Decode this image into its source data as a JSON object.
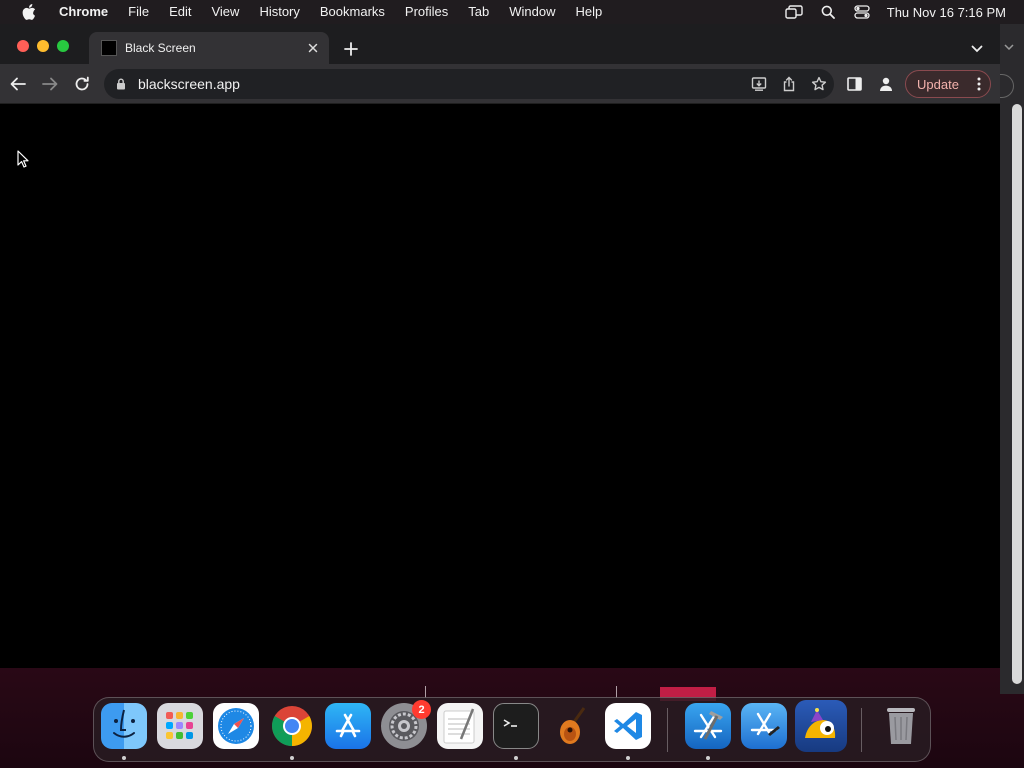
{
  "menubar": {
    "app_name": "Chrome",
    "items": [
      "File",
      "Edit",
      "View",
      "History",
      "Bookmarks",
      "Profiles",
      "Tab",
      "Window",
      "Help"
    ],
    "clock": "Thu Nov 16  7:16 PM",
    "status_icons": [
      "screen-mirroring-icon",
      "search-icon",
      "control-center-icon"
    ]
  },
  "browser": {
    "tab": {
      "title": "Black Screen"
    },
    "url": "blackscreen.app",
    "update_label": "Update",
    "colors": {
      "update_text": "#f3b2ad",
      "toolbar": "#333235",
      "content": "#000000"
    }
  },
  "dock": {
    "apps": [
      "Finder",
      "Launchpad",
      "Safari",
      "Google Chrome",
      "App Store",
      "System Settings",
      "TextEdit",
      "Terminal",
      "GarageBand",
      "Visual Studio Code",
      "Xcode",
      "Simulator",
      "Game",
      "Trash"
    ],
    "settings_badge": "2"
  }
}
